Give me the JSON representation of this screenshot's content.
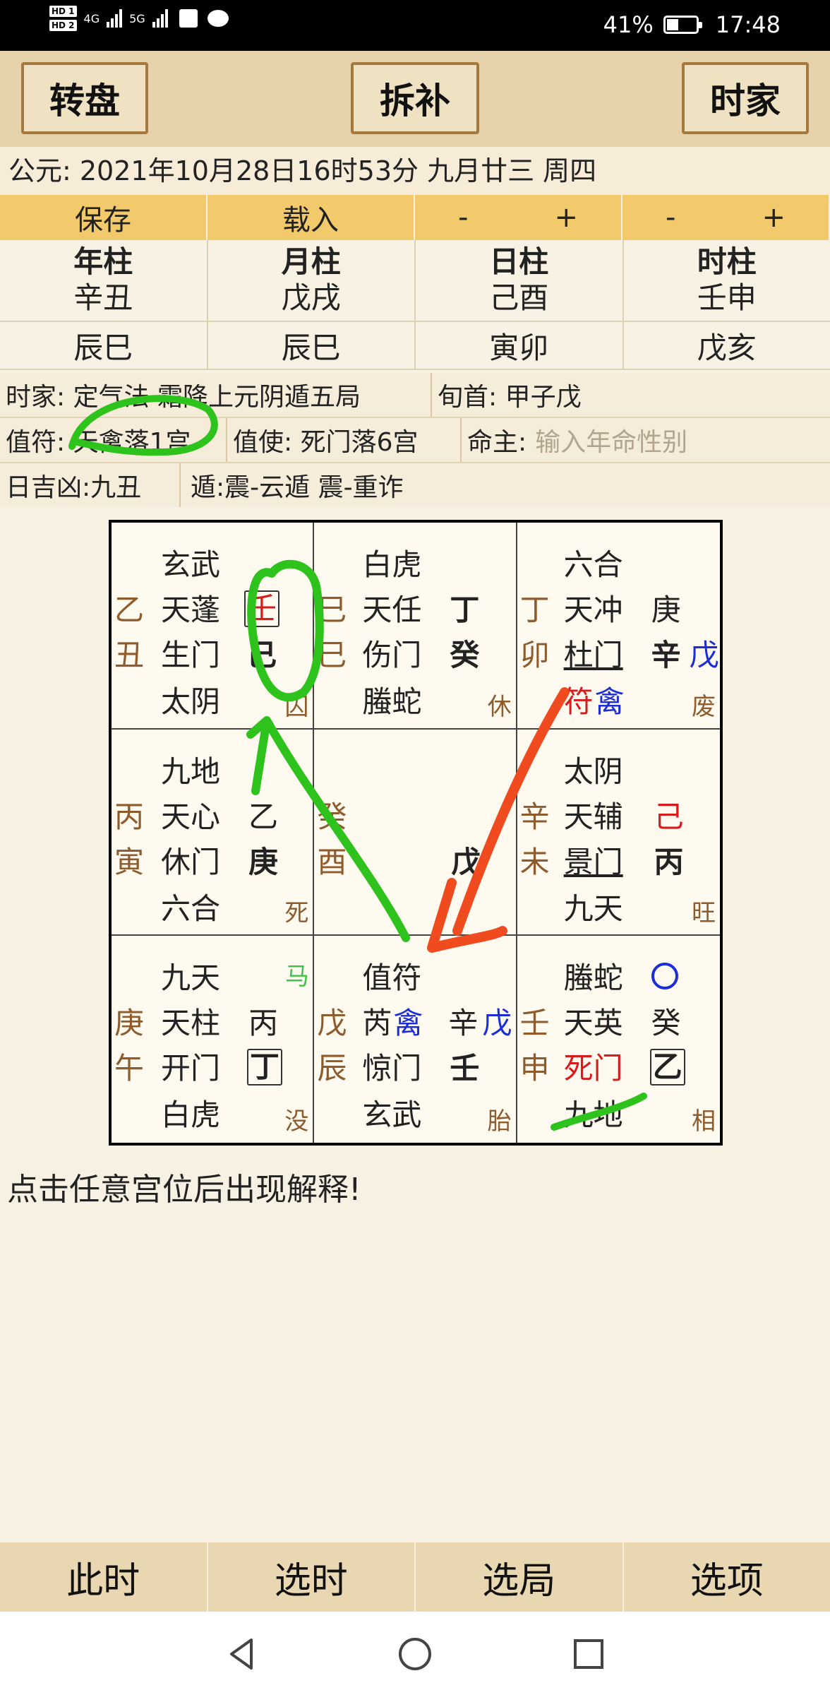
{
  "status": {
    "hd1": "HD 1",
    "hd2": "HD 2",
    "net1": "4G",
    "net2": "5G",
    "battery_text": "41%",
    "battery_level": 0.41,
    "time": "17:48"
  },
  "toolbar": {
    "left": "转盘",
    "center": "拆补",
    "right": "时家"
  },
  "date_line": "公元:  2021年10月28日16时53分 九月廿三 周四",
  "controls": {
    "save": "保存",
    "load": "载入",
    "minus": "-",
    "plus": "+"
  },
  "pillars": [
    {
      "title": "年柱",
      "ganzhi": "辛丑",
      "kong": "辰巳"
    },
    {
      "title": "月柱",
      "ganzhi": "戊戌",
      "kong": "辰巳"
    },
    {
      "title": "日柱",
      "ganzhi": "己酉",
      "kong": "寅卯"
    },
    {
      "title": "时柱",
      "ganzhi": "壬申",
      "kong": "戊亥"
    }
  ],
  "info": {
    "ju": "时家: 定气法  霜降上元阴遁五局",
    "xunshou": "旬首: 甲子戊",
    "zhifu": "值符: 天禽落1宫",
    "zhishi": "值使: 死门落6宫",
    "mingzhu_label": "命主:",
    "mingzhu_placeholder": "输入年命性别",
    "rijixiong": "日吉凶:九丑",
    "dun": "遁:震-云遁  震-重诈"
  },
  "palaces": {
    "p4": {
      "god": "玄武",
      "star": "天蓬",
      "star_stem": "壬",
      "door": "生门",
      "door_stem": "己",
      "deity": "太阴",
      "side_top": "乙",
      "side_bottom": "丑",
      "state": "囚"
    },
    "p9": {
      "god": "白虎",
      "star": "天任",
      "star_stem": "丁",
      "door": "伤门",
      "door_stem": "癸",
      "deity": "螣蛇",
      "side_top": "巳",
      "side_bottom": "巳",
      "state": "休"
    },
    "p2": {
      "god": "六合",
      "star": "天冲",
      "star_stem": "庚",
      "door": "杜门",
      "door_stem": "辛",
      "door_stem2": "戊",
      "deity_a": "符",
      "deity_b": "禽",
      "side_top": "丁",
      "side_bottom": "卯",
      "state": "废"
    },
    "p3": {
      "god": "九地",
      "star": "天心",
      "star_stem": "乙",
      "door": "休门",
      "door_stem": "庚",
      "deity": "六合",
      "side_top": "丙",
      "side_bottom": "寅",
      "state": "死"
    },
    "p5": {
      "side_top": "癸",
      "side_bottom": "酉",
      "center_stem": "戊"
    },
    "p7": {
      "god": "太阴",
      "star": "天辅",
      "star_stem": "己",
      "door": "景门",
      "door_stem": "丙",
      "deity": "九天",
      "side_top": "辛",
      "side_bottom": "未",
      "state": "旺"
    },
    "p8": {
      "god": "九天",
      "star": "天柱",
      "star_stem": "丙",
      "door": "开门",
      "door_stem": "丁",
      "deity": "白虎",
      "side_top": "庚",
      "side_bottom": "午",
      "state": "没",
      "horse": "马"
    },
    "p1": {
      "god": "值符",
      "star_a": "芮",
      "star_b": "禽",
      "star_stem": "辛",
      "star_stem2": "戊",
      "door": "惊门",
      "door_stem": "壬",
      "deity": "玄武",
      "side_top": "戊",
      "side_bottom": "辰",
      "state": "胎"
    },
    "p6": {
      "god": "螣蛇",
      "star": "天英",
      "star_stem": "癸",
      "door": "死门",
      "door_stem": "乙",
      "deity": "九地",
      "side_top": "壬",
      "side_bottom": "申",
      "state": "相"
    }
  },
  "hint": "点击任意宫位后出现解释!",
  "bottom_tabs": [
    "此时",
    "选时",
    "选局",
    "选项"
  ],
  "colors": {
    "toolbar": "#e6d3ac",
    "control": "#f3ca6b",
    "annotation_green": "#2ec21c",
    "annotation_red": "#f04a1f"
  }
}
